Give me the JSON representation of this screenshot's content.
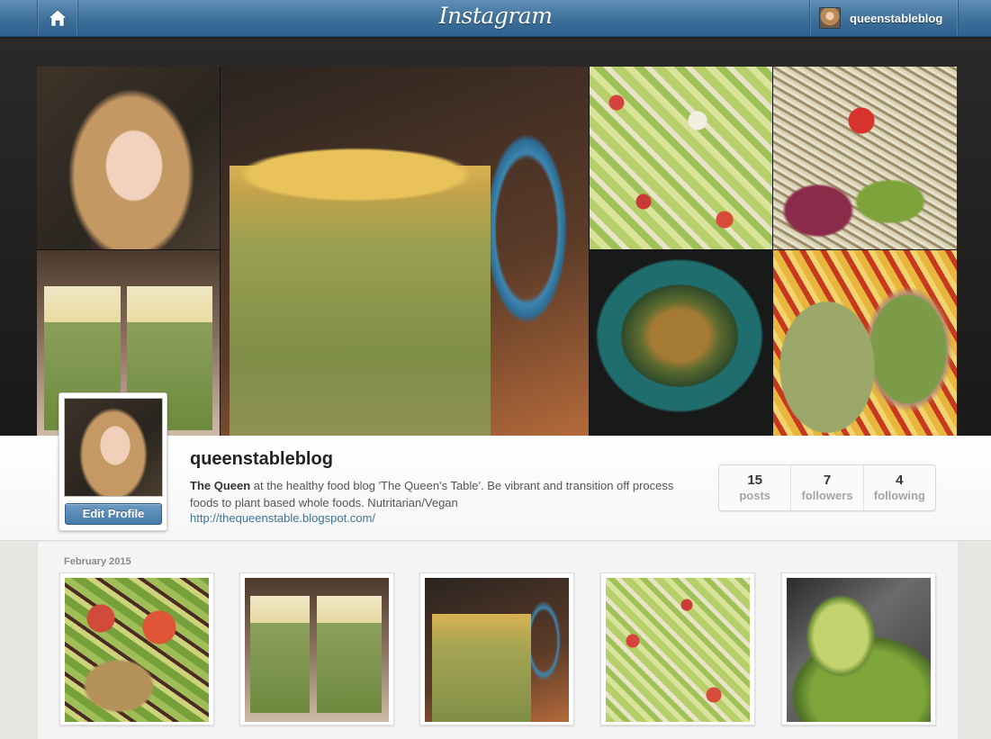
{
  "header": {
    "brand": "Instagram",
    "username": "queenstableblog",
    "home_icon": "home-icon"
  },
  "profile": {
    "username": "queenstableblog",
    "bio_name": "The Queen",
    "bio_text": " at the healthy food blog 'The Queen's Table'. Be vibrant and transition off process foods to plant based whole foods. Nutritarian/Vegan",
    "link": "http://thequeenstable.blogspot.com/",
    "edit_button": "Edit Profile",
    "stats": [
      {
        "value": "15",
        "label": "posts"
      },
      {
        "value": "7",
        "label": "followers"
      },
      {
        "value": "4",
        "label": "following"
      }
    ]
  },
  "feed": {
    "month_label": "February 2015"
  },
  "colors": {
    "topbar": "#3d6f99",
    "link": "#3f729b",
    "button": "#4679a8"
  }
}
